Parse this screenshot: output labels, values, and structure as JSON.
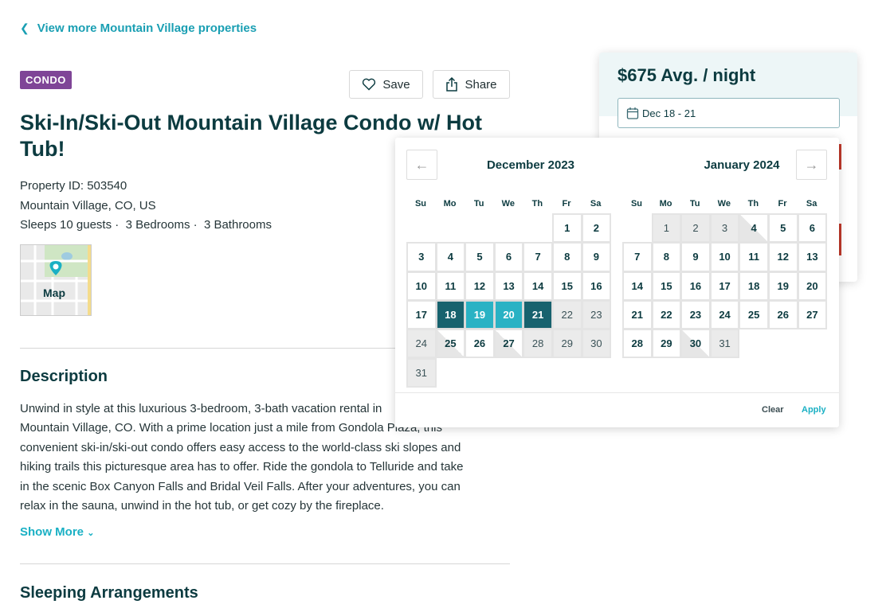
{
  "back_link": "View more Mountain Village properties",
  "badge": "CONDO",
  "save_label": "Save",
  "share_label": "Share",
  "title": "Ski-In/Ski-Out Mountain Village Condo w/ Hot Tub!",
  "property_id": "Property ID: 503540",
  "location": "Mountain Village, CO, US",
  "capacity": "Sleeps 10 guests ·  3 Bedrooms ·  3 Bathrooms",
  "map_label": "Map",
  "description": {
    "heading": "Description",
    "lines": [
      "Unwind in style at this luxurious 3-bedroom, 3-bath vacation rental in",
      "Mountain Village, CO. With a prime location just a mile from Gondola Plaza, this",
      "convenient ski-in/ski-out condo offers easy access to the world-class ski slopes and",
      "hiking trails this picturesque area has to offer. Ride the gondola to Telluride and take",
      "in the scenic Box Canyon Falls and Bridal Veil Falls. After your adventures, you can",
      "relax in the sauna, unwind in the hot tub, or get cozy by the fireplace."
    ],
    "show_more": "Show More"
  },
  "sleeping_heading": "Sleeping Arrangements",
  "booking": {
    "price": "$675 Avg. / night",
    "dates": "Dec 18 - 21"
  },
  "calendar": {
    "weekdays": [
      "Su",
      "Mo",
      "Tu",
      "We",
      "Th",
      "Fr",
      "Sa"
    ],
    "months": [
      {
        "title": "December 2023",
        "first_weekday": 5,
        "days": 31,
        "unavailable": [
          22,
          23,
          24,
          28,
          29,
          30,
          31
        ],
        "half": [
          25,
          27
        ],
        "selected_ends": [
          18,
          21
        ],
        "selected_mid": [
          19,
          20
        ]
      },
      {
        "title": "January 2024",
        "first_weekday": 1,
        "days": 31,
        "unavailable": [
          1,
          2,
          3,
          31
        ],
        "half": [
          4,
          30
        ],
        "selected_ends": [],
        "selected_mid": []
      }
    ],
    "clear": "Clear",
    "apply": "Apply"
  },
  "colors": {
    "accent": "#1ab0c4",
    "selected_end": "#17626e",
    "selected_mid": "#29b2c4",
    "badge": "#7f4597"
  }
}
